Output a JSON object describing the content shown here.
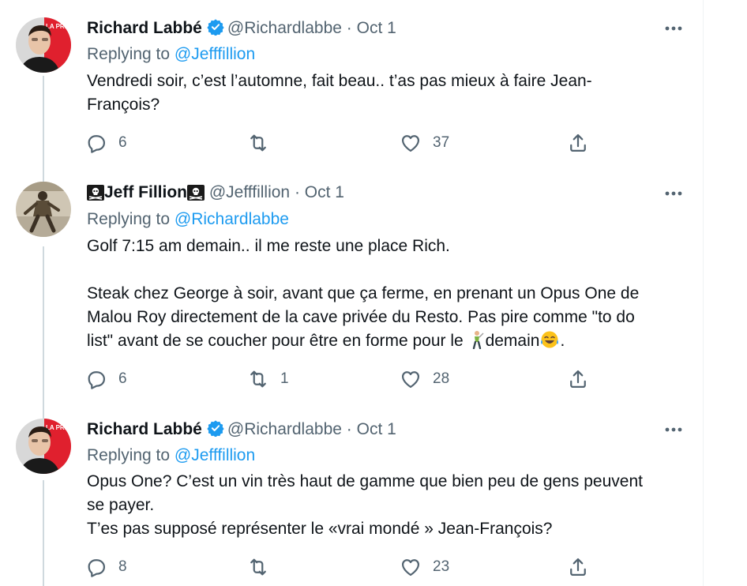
{
  "tweets": [
    {
      "author": "Richard Labbé",
      "handle": "@Richardlabbe",
      "date": "· Oct 1",
      "verified": true,
      "avatar_badge": "LA PRESSE",
      "replying_label": "Replying to",
      "replying_to": "@Jefffillion",
      "body": [
        "Vendredi soir, c’est l’automne, fait beau.. t’as pas mieux à faire Jean-",
        "François?"
      ],
      "reply_count": "6",
      "retweet_count": "",
      "like_count": "37"
    },
    {
      "author_prefix_icon": "skull-crossbones",
      "author": "Jeff Fillion",
      "author_suffix_icon": "skull-crossbones",
      "handle": "@Jefffillion",
      "date": "· Oct 1",
      "verified": false,
      "replying_label": "Replying to",
      "replying_to": "@Richardlabbe",
      "body": [
        "Golf 7:15 am demain.. il me reste une place Rich.",
        "",
        "Steak chez George à soir, avant que ça ferme, en prenant un Opus One de",
        "Malou Roy directement de la cave privée du Resto. Pas pire comme \"to do",
        "list\" avant de se coucher pour être en forme pour le ",
        "demain",
        "."
      ],
      "body_emojis": [
        "golfer",
        "tears-of-joy"
      ],
      "reply_count": "6",
      "retweet_count": "1",
      "like_count": "28"
    },
    {
      "author": "Richard Labbé",
      "handle": "@Richardlabbe",
      "date": "· Oct 1",
      "verified": true,
      "avatar_badge": "LA PRESSE",
      "replying_label": "Replying to",
      "replying_to": "@Jefffillion",
      "body": [
        "Opus One? C’est un vin très haut de gamme que bien peu de gens peuvent",
        "se payer.",
        "T’es pas supposé représenter le «vrai mondé » Jean-François?"
      ],
      "reply_count": "8",
      "retweet_count": "",
      "like_count": "23"
    }
  ],
  "colors": {
    "text": "#0f1419",
    "muted": "#536471",
    "link": "#1d9bf0",
    "verified": "#1d9bf0",
    "thread_line": "#cfd9de",
    "badge_red": "#e0202e"
  },
  "icons": [
    "reply-icon",
    "retweet-icon",
    "like-icon",
    "share-icon",
    "more-icon",
    "verified-badge-icon"
  ]
}
